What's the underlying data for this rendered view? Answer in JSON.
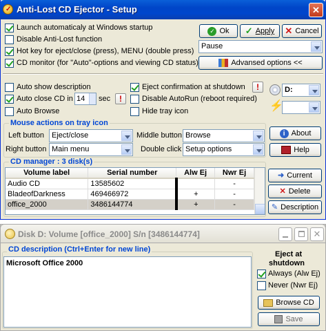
{
  "main_window": {
    "title": "Anti-Lost CD Ejector - Setup",
    "options": {
      "launch_auto": {
        "label": "Launch automaticaly at Windows startup",
        "checked": true
      },
      "disable_antilost": {
        "label": "Disable Anti-Lost function",
        "checked": false
      },
      "hotkey": {
        "label": "Hot key for eject/close (press), MENU (double press)",
        "checked": true
      },
      "cd_monitor": {
        "label": "CD monitor (for \"Auto\"-options and viewing CD status)",
        "checked": true
      }
    },
    "buttons": {
      "ok": "Ok",
      "apply": "Apply",
      "cancel": "Cancel",
      "advanced": "Advansed options <<"
    },
    "hotkey_combo": "Pause",
    "options2": {
      "auto_show_desc": {
        "label": "Auto show description",
        "checked": false
      },
      "auto_close": {
        "label": "Auto close CD in",
        "checked": true,
        "seconds": "14",
        "unit": "sec"
      },
      "auto_browse": {
        "label": "Auto Browse",
        "checked": false
      },
      "eject_confirm": {
        "label": "Eject confirmation at shutdown",
        "checked": true
      },
      "disable_autorun": {
        "label": "Disable AutoRun (reboot required)",
        "checked": false
      },
      "hide_tray": {
        "label": "Hide tray icon",
        "checked": false
      }
    },
    "drive_combo": "D:",
    "drive_combo2": "",
    "excl_mark": "!",
    "mouse_group": {
      "title": "Mouse actions on tray icon",
      "left_label": "Left button",
      "left_value": "Eject/close",
      "right_label": "Right button",
      "right_value": "Main menu",
      "middle_label": "Middle button",
      "middle_value": "Browse",
      "double_label": "Double click",
      "double_value": "Setup options"
    },
    "about_btn": "About",
    "help_btn": "Help",
    "cd_manager": {
      "title": "CD manager : 3 disk(s)",
      "columns": [
        "Volume label",
        "Serial number",
        "Alw Ej",
        "Nwr Ej"
      ],
      "rows": [
        {
          "label": "Audio CD",
          "serial": "13585602",
          "alw": "",
          "nwr": "-"
        },
        {
          "label": "BladeofDarkness",
          "serial": "469466972",
          "alw": "+",
          "nwr": "-"
        },
        {
          "label": "office_2000",
          "serial": "3486144774",
          "alw": "+",
          "nwr": "-"
        }
      ],
      "current_btn": "Current",
      "delete_btn": "Delete",
      "description_btn": "Description"
    }
  },
  "disk_window": {
    "title": "Disk D:   Volume [office_2000]  S/n [3486144774]",
    "desc_title": "CD description (Ctrl+Enter for new line)",
    "desc_text": "Microsoft Office 2000",
    "eject_title_1": "Eject at",
    "eject_title_2": "shutdown",
    "always": {
      "label": "Always (Alw Ej)",
      "checked": true
    },
    "never": {
      "label": "Never (Nwr Ej)",
      "checked": false
    },
    "browse_btn": "Browse CD",
    "save_btn": "Save"
  }
}
